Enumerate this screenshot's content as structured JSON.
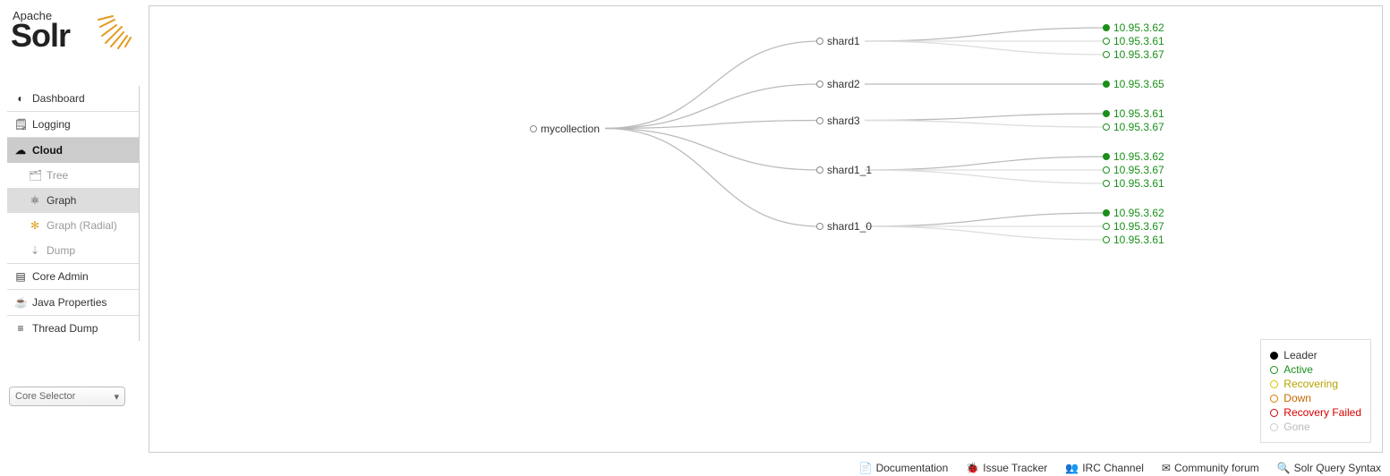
{
  "brand": {
    "small": "Apache",
    "big": "Solr"
  },
  "sidebar": {
    "items": [
      {
        "key": "dashboard",
        "label": "Dashboard"
      },
      {
        "key": "logging",
        "label": "Logging"
      },
      {
        "key": "cloud",
        "label": "Cloud",
        "active": true,
        "children": [
          {
            "key": "tree",
            "label": "Tree"
          },
          {
            "key": "graph",
            "label": "Graph",
            "active": true
          },
          {
            "key": "graph-radial",
            "label": "Graph (Radial)"
          },
          {
            "key": "dump",
            "label": "Dump"
          }
        ]
      },
      {
        "key": "coreadmin",
        "label": "Core Admin"
      },
      {
        "key": "javaprops",
        "label": "Java Properties"
      },
      {
        "key": "threaddump",
        "label": "Thread Dump"
      }
    ]
  },
  "core_selector": "Core Selector",
  "graph": {
    "collection": "mycollection",
    "shards": [
      {
        "name": "shard1",
        "replicas": [
          {
            "ip": "10.95.3.62",
            "status": "leader"
          },
          {
            "ip": "10.95.3.61",
            "status": "active"
          },
          {
            "ip": "10.95.3.67",
            "status": "active"
          }
        ]
      },
      {
        "name": "shard2",
        "replicas": [
          {
            "ip": "10.95.3.65",
            "status": "leader"
          }
        ]
      },
      {
        "name": "shard3",
        "replicas": [
          {
            "ip": "10.95.3.61",
            "status": "leader"
          },
          {
            "ip": "10.95.3.67",
            "status": "active"
          }
        ]
      },
      {
        "name": "shard1_1",
        "replicas": [
          {
            "ip": "10.95.3.62",
            "status": "leader"
          },
          {
            "ip": "10.95.3.67",
            "status": "active"
          },
          {
            "ip": "10.95.3.61",
            "status": "active"
          }
        ]
      },
      {
        "name": "shard1_0",
        "replicas": [
          {
            "ip": "10.95.3.62",
            "status": "leader"
          },
          {
            "ip": "10.95.3.67",
            "status": "active"
          },
          {
            "ip": "10.95.3.61",
            "status": "active"
          }
        ]
      }
    ]
  },
  "legend": {
    "leader": "Leader",
    "active": "Active",
    "recovering": "Recovering",
    "down": "Down",
    "failed": "Recovery Failed",
    "gone": "Gone"
  },
  "footer": {
    "documentation": "Documentation",
    "issue": "Issue Tracker",
    "irc": "IRC Channel",
    "community": "Community forum",
    "query": "Solr Query Syntax"
  }
}
